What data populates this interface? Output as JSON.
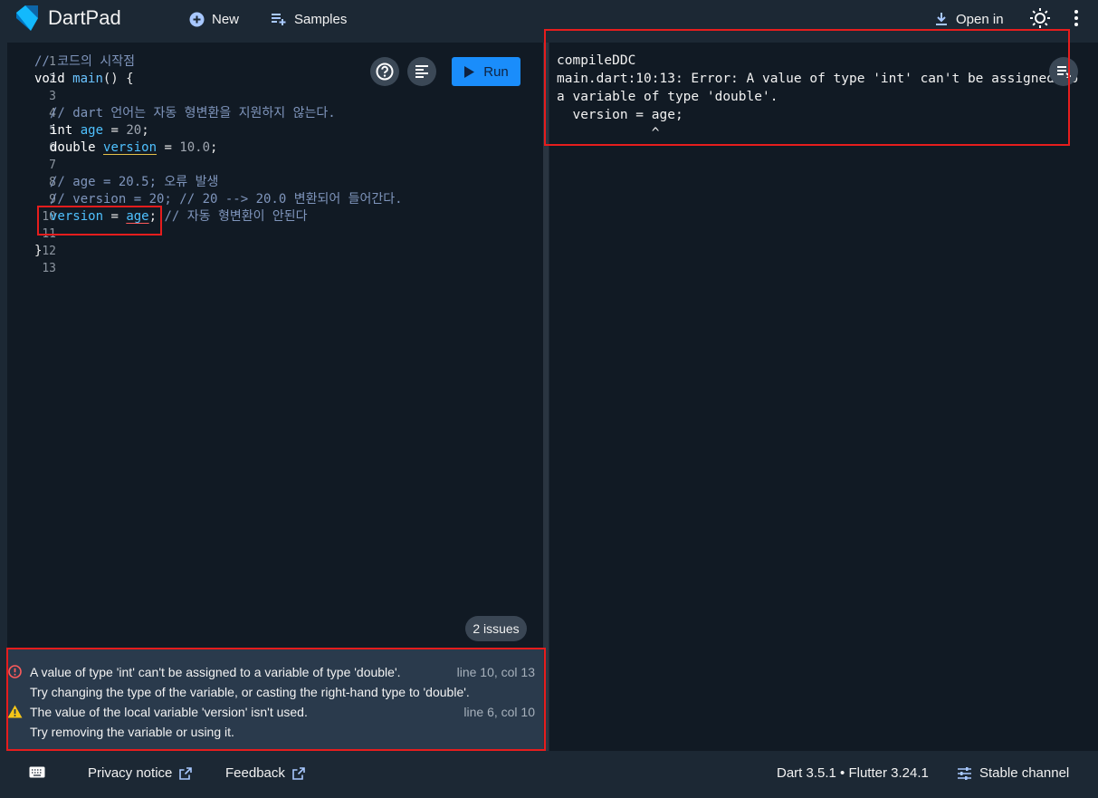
{
  "header": {
    "app_title": "DartPad",
    "new_label": "New",
    "samples_label": "Samples",
    "open_in_label": "Open in"
  },
  "editor": {
    "run_label": "Run",
    "line_numbers": [
      "1",
      "2",
      "3",
      "4",
      "5",
      "6",
      "7",
      "8",
      "9",
      "10",
      "11",
      "12",
      "13"
    ],
    "lines": {
      "l1": "// 코드의 시작점",
      "l2_kw": "void",
      "l2_fn": "main",
      "l2_rest": "() {",
      "l4": "// dart 언어는 자동 형변환을 지원하지 않는다.",
      "l5_kw": "int",
      "l5_var": "age",
      "l5_eq": " = ",
      "l5_num": "20",
      "l5_end": ";",
      "l6_kw": "double",
      "l6_var": "version",
      "l6_eq": " = ",
      "l6_num": "10.0",
      "l6_end": ";",
      "l8": "// age = 20.5; 오류 발생",
      "l9": "// version = 20; // 20 --> 20.0 변환되어 들어간다.",
      "l10_var": "version",
      "l10_eq": " = ",
      "l10_val": "age",
      "l10_end": ";",
      "l10_cm": " // 자동 형변환이 안된다",
      "l12": "}"
    },
    "issues_badge": "2 issues"
  },
  "problems": {
    "items": [
      {
        "message": "A value of type 'int' can't be assigned to a variable of type 'double'.",
        "location": "line 10, col 13",
        "hint": "Try changing the type of the variable, or casting the right-hand type to 'double'.",
        "severity": "error"
      },
      {
        "message": "The value of the local variable 'version' isn't used.",
        "location": "line 6, col 10",
        "hint": "Try removing the variable or using it.",
        "severity": "warning"
      }
    ]
  },
  "output": {
    "lines": [
      "compileDDC",
      "main.dart:10:13: Error: A value of type 'int' can't be assigned to",
      "a variable of type 'double'.",
      "  version = age;",
      "            ^"
    ]
  },
  "footer": {
    "privacy_label": "Privacy notice",
    "feedback_label": "Feedback",
    "version_label": "Dart 3.5.1 • Flutter 3.24.1",
    "channel_label": "Stable channel"
  },
  "colors": {
    "accent": "#1a8dfb",
    "error": "#ff5b5b",
    "warning": "#f5c518",
    "highlight_box": "#e61d1d"
  }
}
